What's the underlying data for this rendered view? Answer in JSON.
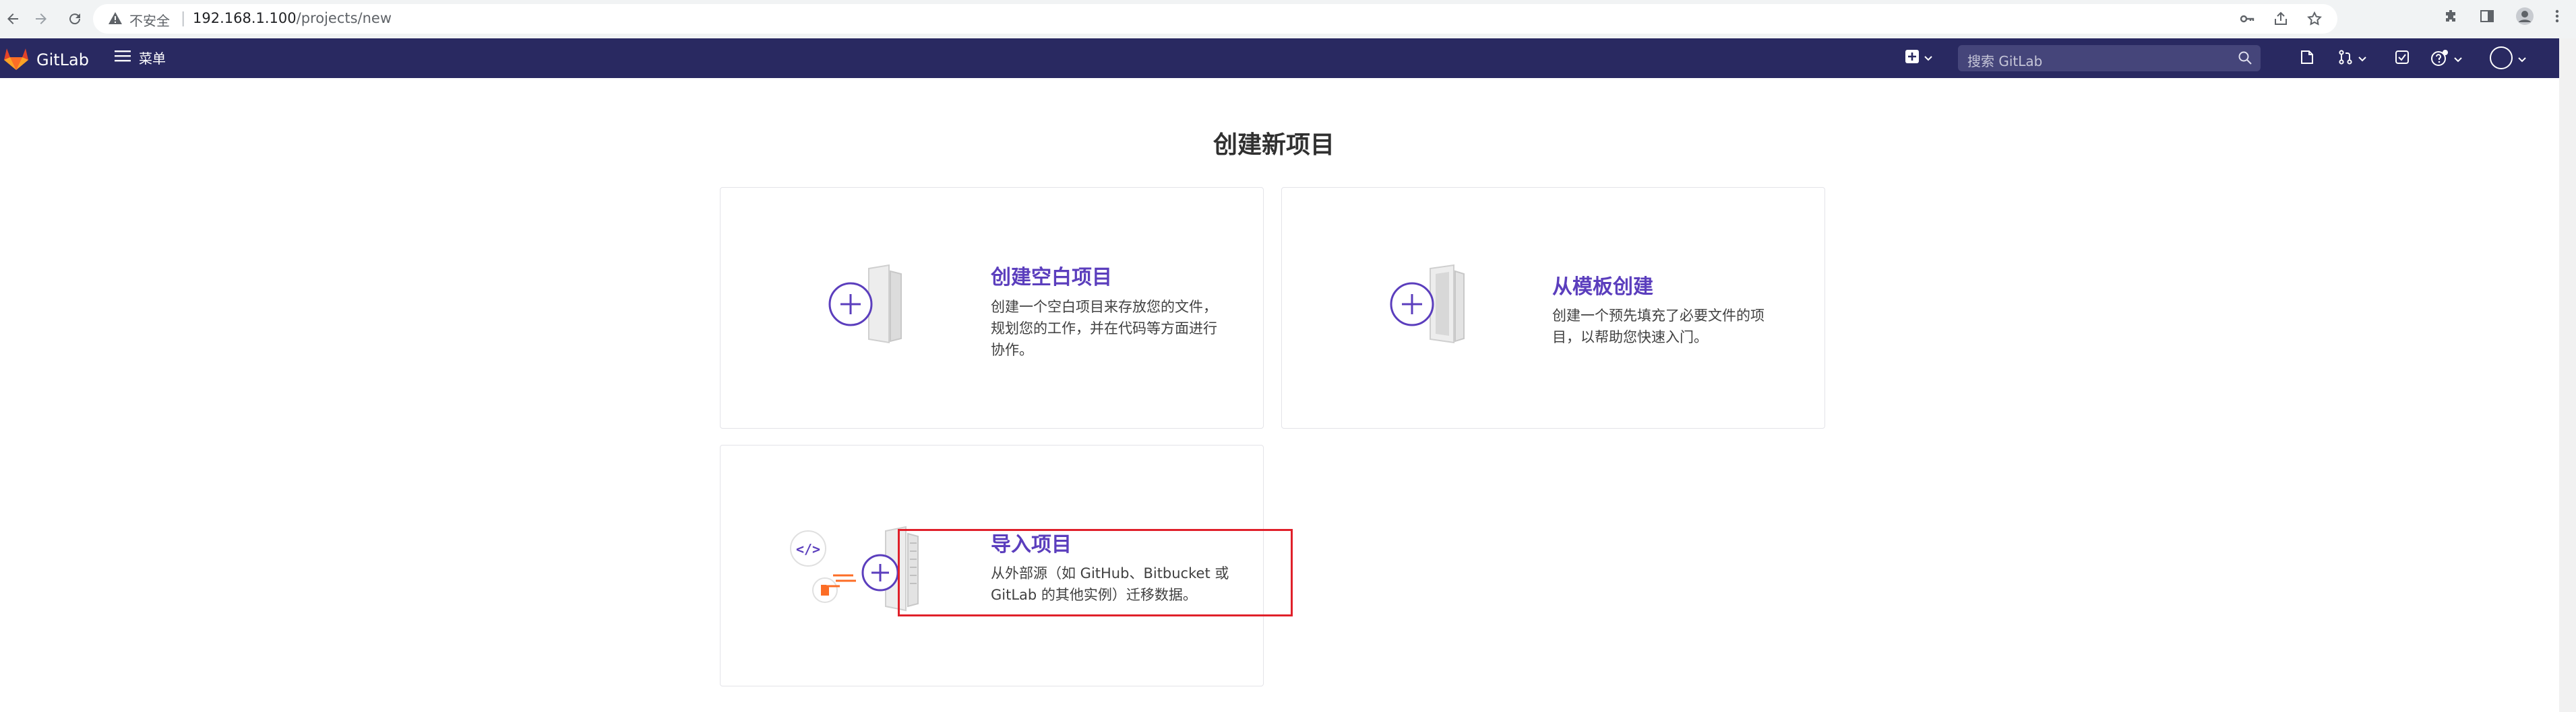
{
  "browser": {
    "insecure_label": "不安全",
    "url_host": "192.168.1.100",
    "url_path": "/projects/new",
    "icons": [
      "back-arrow-icon",
      "forward-arrow-icon",
      "reload-icon",
      "warning-icon",
      "key-icon",
      "share-icon",
      "star-icon",
      "extensions-icon",
      "sidepanel-icon",
      "profile-icon",
      "kebab-menu-icon"
    ]
  },
  "navbar": {
    "brand": "GitLab",
    "menu_label": "菜单",
    "search_placeholder": "搜索 GitLab",
    "colors": {
      "background": "#292961",
      "search_bg": "#45457a"
    },
    "icons": [
      "new-item-icon",
      "todo-issue-icon",
      "merge-request-icon",
      "todo-check-icon",
      "help-icon",
      "avatar"
    ]
  },
  "page": {
    "title": "创建新项目"
  },
  "cards": {
    "blank": {
      "title": "创建空白项目",
      "desc_line1": "创建一个空白项目来存放您的文件，",
      "desc_line2": "规划您的工作，并在代码等方面进行",
      "desc_line3": "协作。"
    },
    "template": {
      "title": "从模板创建",
      "desc_line1": "创建一个预先填充了必要文件的项",
      "desc_line2": "目，以帮助您快速入门。"
    },
    "import": {
      "title": "导入项目",
      "desc_line1": "从外部源（如 GitHub、Bitbucket 或",
      "desc_line2": "GitLab 的其他实例）迁移数据。"
    }
  },
  "accent_color": "#5b3ebd",
  "highlight_color": "#e0202a"
}
